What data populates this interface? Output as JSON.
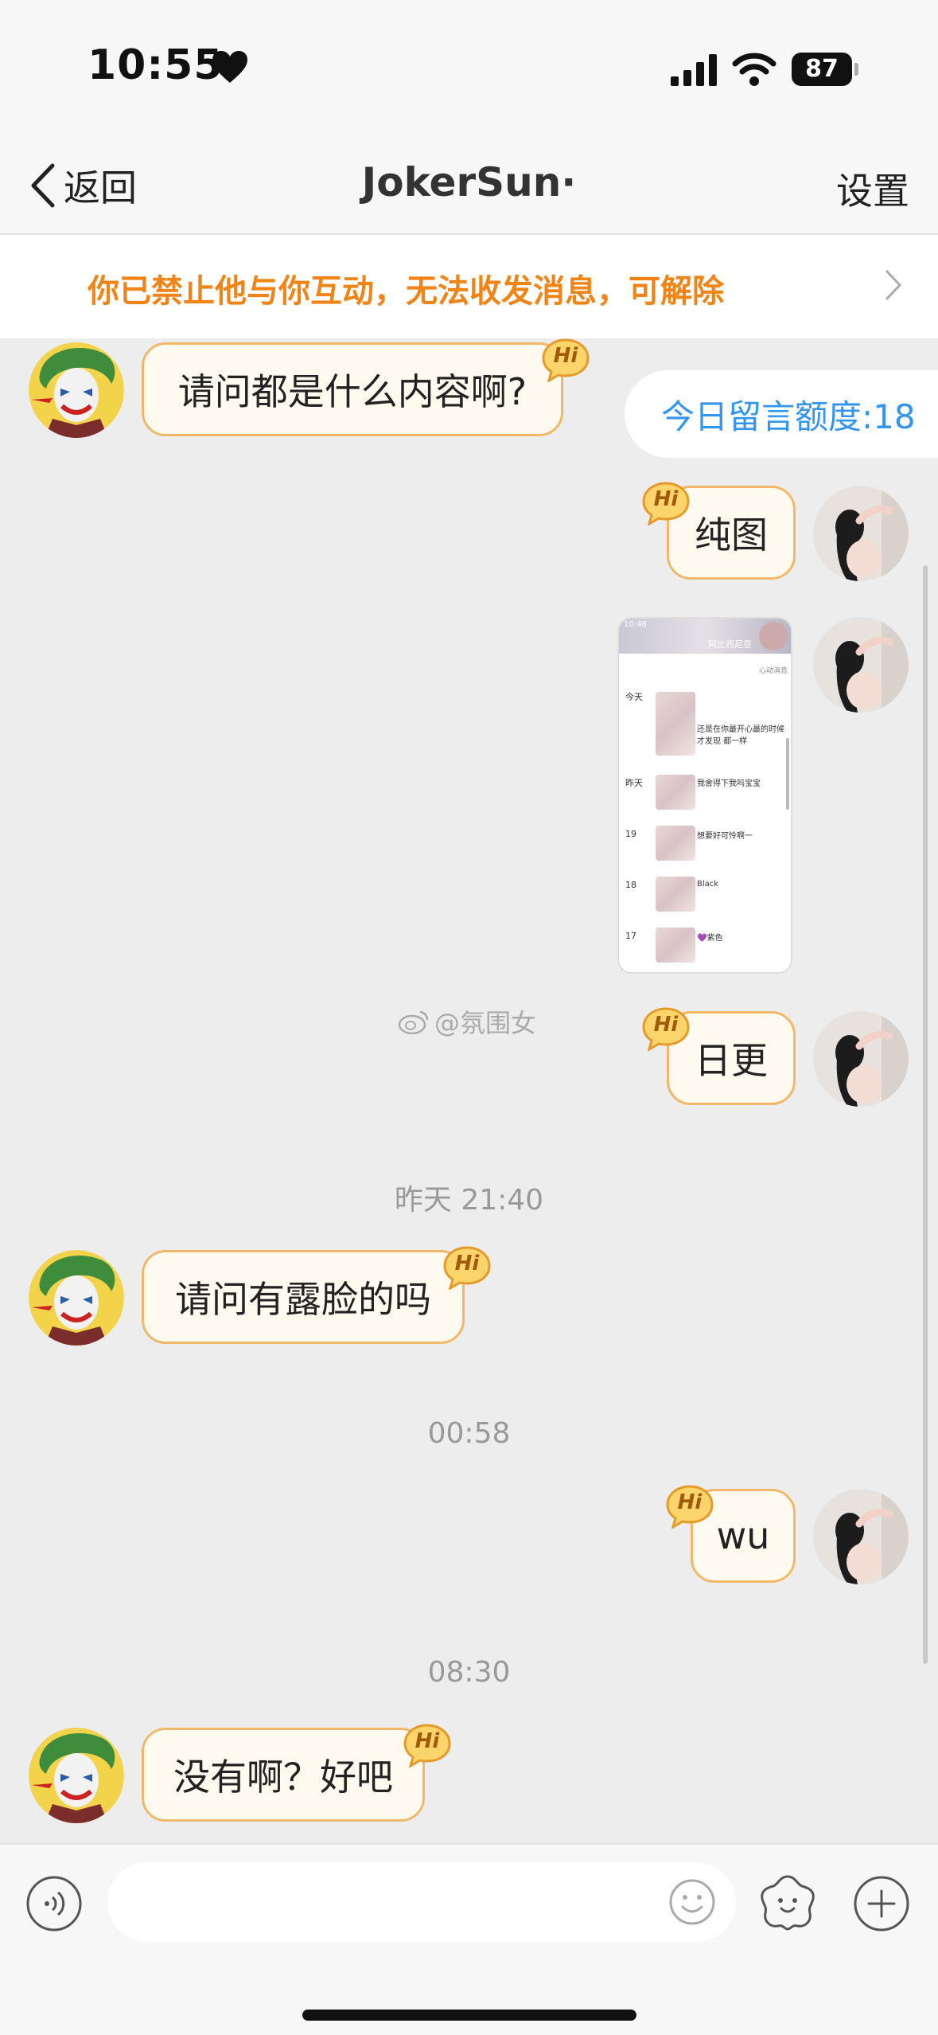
{
  "status_bar": {
    "time": "10:55",
    "battery": "87"
  },
  "nav": {
    "back_label": "返回",
    "title": "JokerSun·",
    "settings_label": "设置"
  },
  "banner": {
    "text": "你已禁止他与你互动，无法收发消息，可解除"
  },
  "quota": {
    "text": "今日留言额度:18"
  },
  "messages": [
    {
      "sender": "other",
      "text": "请问都是什么内容啊?"
    },
    {
      "sender": "me",
      "text": "纯图"
    },
    {
      "sender": "me",
      "type": "image"
    },
    {
      "sender": "me",
      "text": "日更"
    },
    {
      "type": "timestamp",
      "text": "昨天 21:40"
    },
    {
      "sender": "other",
      "text": "请问有露脸的吗"
    },
    {
      "type": "timestamp",
      "text": "00:58"
    },
    {
      "sender": "me",
      "text": "wu"
    },
    {
      "type": "timestamp",
      "text": "08:30"
    },
    {
      "sender": "other",
      "text": "没有啊？好吧"
    }
  ],
  "hi_badge": "Hi",
  "image_preview": {
    "header": "阿比西尼亚",
    "sub": "心动消息",
    "rows": [
      {
        "date": "今天",
        "text": "还是在你最开心最的时候 才发现 都一样"
      },
      {
        "date": "昨天",
        "text": "我舍得下我吗宝宝"
      },
      {
        "date": "19",
        "text": "想要好可怜啊一"
      },
      {
        "date": "18",
        "text": "Black"
      },
      {
        "date": "17",
        "text": "💜紫色"
      }
    ]
  },
  "watermark": "@氛围女",
  "icons": {
    "voice": "voice-icon",
    "emoji": "emoji-icon",
    "sticker": "sticker-icon",
    "plus": "plus-icon"
  },
  "colors": {
    "accent_orange": "#f08416",
    "bubble_border": "#f2b868",
    "quota_blue": "#3296f0"
  }
}
